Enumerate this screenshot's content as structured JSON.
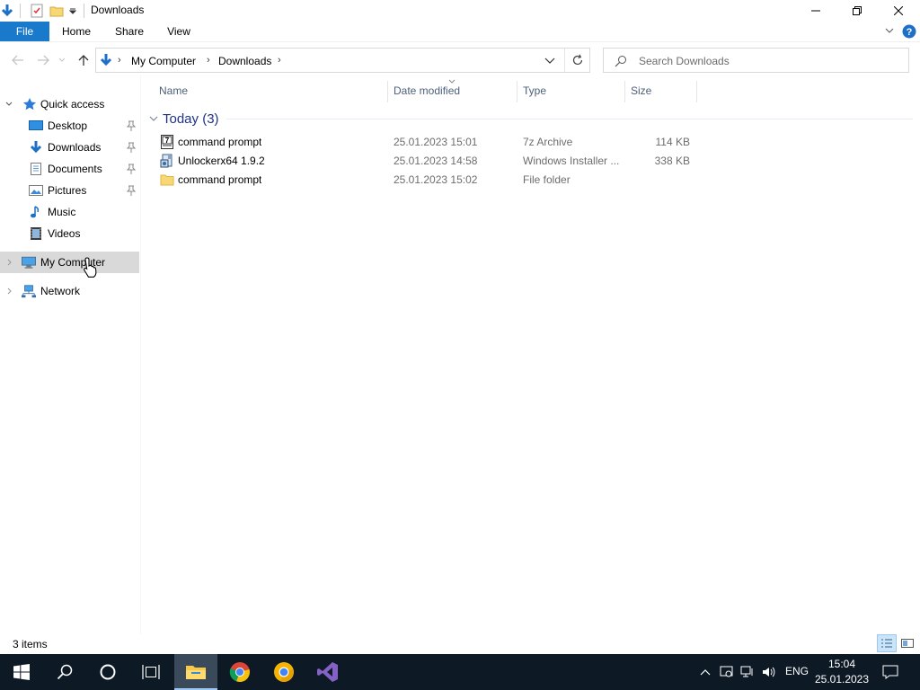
{
  "window": {
    "title": "Downloads",
    "controls": [
      "minimize",
      "restore",
      "close"
    ]
  },
  "ribbon": {
    "tabs": [
      "File",
      "Home",
      "Share",
      "View"
    ]
  },
  "address": {
    "crumbs": [
      "My Computer",
      "Downloads"
    ],
    "search_placeholder": "Search Downloads"
  },
  "sidebar": {
    "quick_access": "Quick access",
    "items": [
      {
        "label": "Desktop",
        "icon": "desktop-icon",
        "pinned": true
      },
      {
        "label": "Downloads",
        "icon": "downloads-icon",
        "pinned": true
      },
      {
        "label": "Documents",
        "icon": "documents-icon",
        "pinned": true
      },
      {
        "label": "Pictures",
        "icon": "pictures-icon",
        "pinned": true
      },
      {
        "label": "Music",
        "icon": "music-icon",
        "pinned": false
      },
      {
        "label": "Videos",
        "icon": "videos-icon",
        "pinned": false
      }
    ],
    "my_computer": "My Computer",
    "network": "Network"
  },
  "columns": {
    "name": "Name",
    "date": "Date modified",
    "type": "Type",
    "size": "Size"
  },
  "group": {
    "label": "Today (3)"
  },
  "files": [
    {
      "name": "command prompt",
      "date": "25.01.2023 15:01",
      "type": "7z Archive",
      "size": "114 KB",
      "icon": "archive-icon"
    },
    {
      "name": "Unlockerx64 1.9.2",
      "date": "25.01.2023 14:58",
      "type": "Windows Installer ...",
      "size": "338 KB",
      "icon": "installer-icon"
    },
    {
      "name": "command prompt",
      "date": "25.01.2023 15:02",
      "type": "File folder",
      "size": "",
      "icon": "folder-icon"
    }
  ],
  "status": {
    "items_count": "3 items"
  },
  "taskbar": {
    "language": "ENG",
    "time": "15:04",
    "date": "25.01.2023"
  },
  "colors": {
    "accent": "#1979ca",
    "selected": "#d9d9d9",
    "group_header": "#1e3287",
    "taskbar": "#0d1a26"
  }
}
